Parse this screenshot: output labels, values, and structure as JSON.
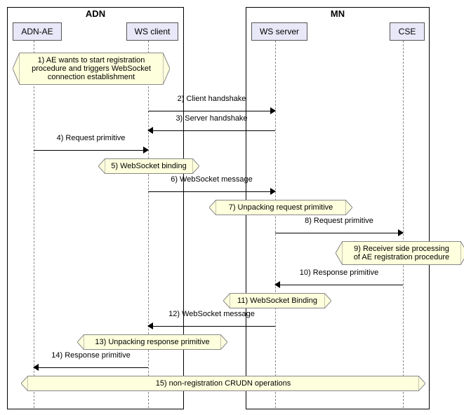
{
  "groups": {
    "adn": {
      "title": "ADN"
    },
    "mn": {
      "title": "MN"
    }
  },
  "participants": {
    "adn_ae": "ADN-AE",
    "ws_client": "WS client",
    "ws_server": "WS server",
    "cse": "CSE"
  },
  "notes": {
    "n1": "1) AE wants to start registration\nprocedure and triggers WebSocket\nconnection establishment",
    "n5": "5) WebSocket binding",
    "n7": "7) Unpacking request primitive",
    "n9": "9) Receiver side processing\nof AE registration procedure",
    "n11": "11) WebSocket Binding",
    "n13": "13) Unpacking response primitive",
    "n15": "15) non-registration CRUDN operations"
  },
  "messages": {
    "m2": "2) Client handshake",
    "m3": "3) Server handshake",
    "m4": "4) Request primitive",
    "m6": "6) WebSocket message",
    "m8": "8) Request primitive",
    "m10": "10) Response primitive",
    "m12": "12) WebSocket message",
    "m14": "14) Response primitive"
  },
  "chart_data": {
    "type": "sequence_diagram",
    "groups": [
      {
        "name": "ADN",
        "participants": [
          "ADN-AE",
          "WS client"
        ]
      },
      {
        "name": "MN",
        "participants": [
          "WS server",
          "CSE"
        ]
      }
    ],
    "participants": [
      "ADN-AE",
      "WS client",
      "WS server",
      "CSE"
    ],
    "steps": [
      {
        "n": 1,
        "type": "note",
        "over": [
          "ADN-AE",
          "WS client"
        ],
        "text": "AE wants to start registration procedure and triggers WebSocket connection establishment"
      },
      {
        "n": 2,
        "type": "message",
        "from": "WS client",
        "to": "WS server",
        "text": "Client handshake"
      },
      {
        "n": 3,
        "type": "message",
        "from": "WS server",
        "to": "WS client",
        "text": "Server handshake"
      },
      {
        "n": 4,
        "type": "message",
        "from": "ADN-AE",
        "to": "WS client",
        "text": "Request primitive"
      },
      {
        "n": 5,
        "type": "note",
        "over": [
          "WS client"
        ],
        "text": "WebSocket binding"
      },
      {
        "n": 6,
        "type": "message",
        "from": "WS client",
        "to": "WS server",
        "text": "WebSocket message"
      },
      {
        "n": 7,
        "type": "note",
        "over": [
          "WS server"
        ],
        "text": "Unpacking request primitive"
      },
      {
        "n": 8,
        "type": "message",
        "from": "WS server",
        "to": "CSE",
        "text": "Request primitive"
      },
      {
        "n": 9,
        "type": "note",
        "over": [
          "CSE"
        ],
        "text": "Receiver side processing of AE registration procedure"
      },
      {
        "n": 10,
        "type": "message",
        "from": "CSE",
        "to": "WS server",
        "text": "Response primitive"
      },
      {
        "n": 11,
        "type": "note",
        "over": [
          "WS server"
        ],
        "text": "WebSocket Binding"
      },
      {
        "n": 12,
        "type": "message",
        "from": "WS server",
        "to": "WS client",
        "text": "WebSocket message"
      },
      {
        "n": 13,
        "type": "note",
        "over": [
          "WS client"
        ],
        "text": "Unpacking response primitive"
      },
      {
        "n": 14,
        "type": "message",
        "from": "WS client",
        "to": "ADN-AE",
        "text": "Response primitive"
      },
      {
        "n": 15,
        "type": "note",
        "over": [
          "ADN-AE",
          "WS client",
          "WS server",
          "CSE"
        ],
        "text": "non-registration CRUDN operations"
      }
    ]
  }
}
